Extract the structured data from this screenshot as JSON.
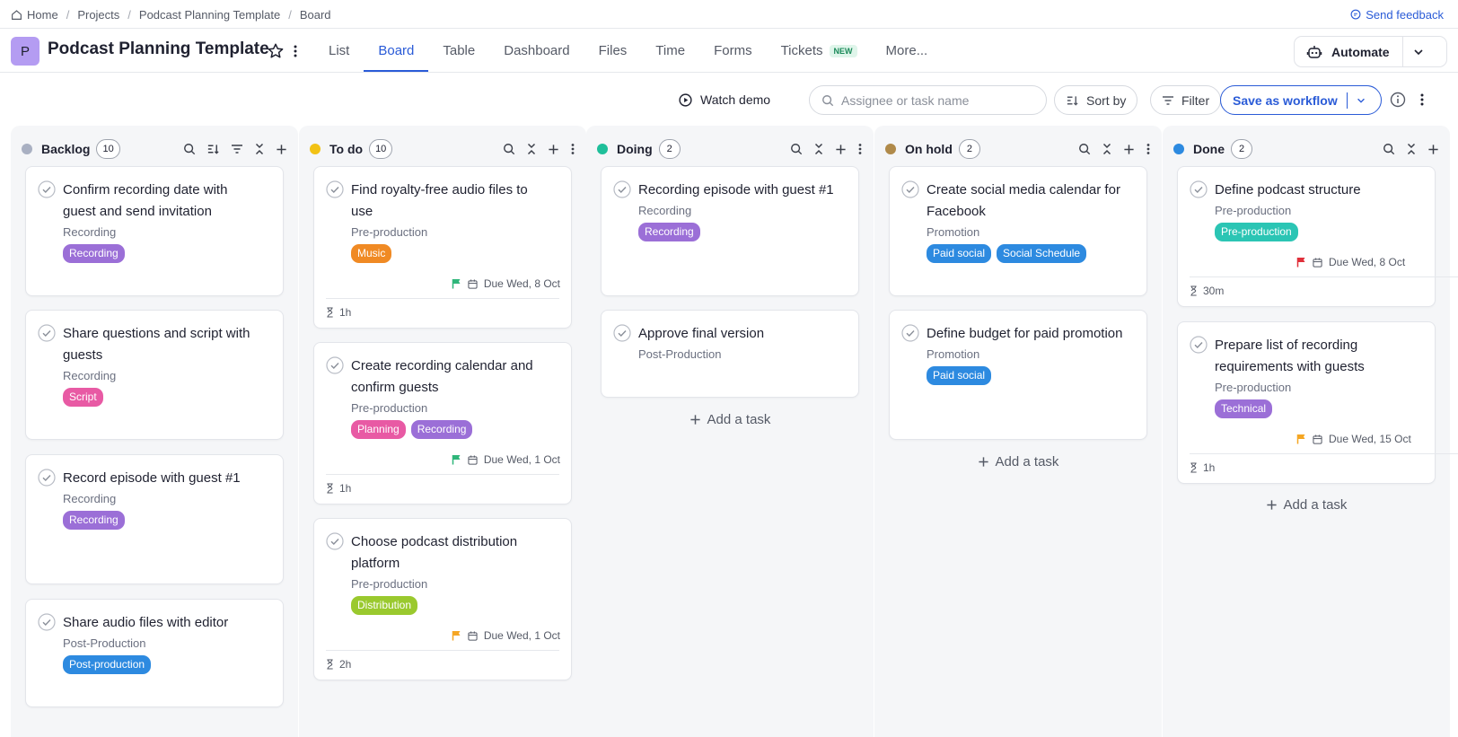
{
  "breadcrumb": [
    "Home",
    "Projects",
    "Podcast Planning Template",
    "Board"
  ],
  "feedback": "Send feedback",
  "project": {
    "initial": "P",
    "title": "Podcast Planning Template",
    "badge_color": "#b49cf2"
  },
  "tabs": [
    "List",
    "Board",
    "Table",
    "Dashboard",
    "Files",
    "Time",
    "Forms",
    "Tickets",
    "More..."
  ],
  "tabs_active": "Board",
  "tickets_badge": "NEW",
  "automate_label": "Automate",
  "toolbar": {
    "watch_demo": "Watch demo",
    "search_placeholder": "Assignee or task name",
    "sort_by": "Sort by",
    "filter": "Filter",
    "save_workflow": "Save as workflow"
  },
  "add_task_label": "Add a task",
  "tag_colors": {
    "Recording": "#9b6fd7",
    "Script": "#e85aa4",
    "Post-production": "#2d8ae0",
    "Music": "#f08a24",
    "Planning": "#e85aa4",
    "Distribution": "#9ac92e",
    "Paid social": "#2d8ae0",
    "Social Schedule": "#2d8ae0",
    "Pre-production": "#2bc5b4",
    "Technical": "#9b6fd7"
  },
  "columns": [
    {
      "name": "Backlog",
      "count": "10",
      "color": "#a9b0c2",
      "cards": [
        {
          "title": "Confirm recording date with guest and send invitation",
          "section": "Recording",
          "tags": [
            "Recording"
          ]
        },
        {
          "title": "Share questions and script with guests",
          "section": "Recording",
          "tags": [
            "Script"
          ]
        },
        {
          "title": "Record episode with guest #1",
          "section": "Recording",
          "tags": [
            "Recording"
          ]
        },
        {
          "title": "Share audio files with editor",
          "section": "Post-Production",
          "tags": [
            "Post-production"
          ]
        }
      ]
    },
    {
      "name": "To do",
      "count": "10",
      "color": "#f2c215",
      "cards": [
        {
          "title": "Find royalty-free audio files to use",
          "section": "Pre-production",
          "tags": [
            "Music"
          ],
          "due": "Due Wed, 8 Oct",
          "flag_color": "#2fb67a",
          "estimate": "1h"
        },
        {
          "title": "Create recording calendar and confirm guests",
          "section": "Pre-production",
          "tags": [
            "Planning",
            "Recording"
          ],
          "due": "Due Wed, 1 Oct",
          "flag_color": "#2fb67a",
          "estimate": "1h"
        },
        {
          "title": "Choose podcast distribution platform",
          "section": "Pre-production",
          "tags": [
            "Distribution"
          ],
          "due": "Due Wed, 1 Oct",
          "flag_color": "#f5a623",
          "estimate": "2h"
        }
      ]
    },
    {
      "name": "Doing",
      "count": "2",
      "color": "#1fbf9a",
      "cards": [
        {
          "title": "Recording episode with guest #1",
          "section": "Recording",
          "tags": [
            "Recording"
          ]
        },
        {
          "title": "Approve final version",
          "section": "Post-Production",
          "tags": []
        }
      ]
    },
    {
      "name": "On hold",
      "count": "2",
      "color": "#b08a4a",
      "cards": [
        {
          "title": "Create social media calendar for Facebook",
          "section": "Promotion",
          "tags": [
            "Paid social",
            "Social Schedule"
          ]
        },
        {
          "title": "Define budget for paid promotion",
          "section": "Promotion",
          "tags": [
            "Paid social"
          ]
        }
      ]
    },
    {
      "name": "Done",
      "count": "2",
      "color": "#2d8ae0",
      "cards": [
        {
          "title": "Define podcast structure",
          "section": "Pre-production",
          "tags": [
            "Pre-production"
          ],
          "due": "Due Wed, 8 Oct",
          "flag_color": "#e0303b",
          "estimate": "30m"
        },
        {
          "title": "Prepare list of recording requirements with guests",
          "section": "Pre-production",
          "tags": [
            "Technical"
          ],
          "due": "Due Wed, 15 Oct",
          "flag_color": "#f5a623",
          "estimate": "1h"
        }
      ]
    }
  ]
}
